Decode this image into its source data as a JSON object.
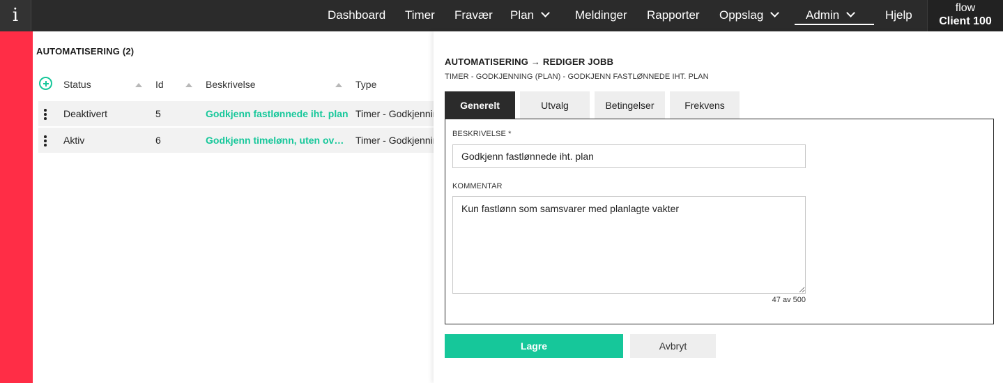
{
  "topbar": {
    "logo_text": "i",
    "nav": [
      {
        "label": "Dashboard",
        "dropdown": false
      },
      {
        "label": "Timer",
        "dropdown": false
      },
      {
        "label": "Fravær",
        "dropdown": false
      },
      {
        "label": "Plan",
        "dropdown": true
      },
      {
        "label": "Meldinger",
        "dropdown": false
      },
      {
        "label": "Rapporter",
        "dropdown": false
      },
      {
        "label": "Oppslag",
        "dropdown": true
      },
      {
        "label": "Admin",
        "dropdown": true,
        "active": true
      },
      {
        "label": "Hjelp",
        "dropdown": false
      }
    ],
    "client": {
      "line1": "flow",
      "line2": "Client 100"
    }
  },
  "list": {
    "title": "AUTOMATISERING (2)",
    "columns": [
      "Status",
      "Id",
      "Beskrivelse",
      "Type"
    ],
    "rows": [
      {
        "status": "Deaktivert",
        "id": "5",
        "beskrivelse": "Godkjenn fastlønnede iht. plan",
        "type": "Timer - Godkjenning"
      },
      {
        "status": "Aktiv",
        "id": "6",
        "beskrivelse": "Godkjenn timelønn, uten overtid",
        "type": "Timer - Godkjenning"
      }
    ]
  },
  "panel": {
    "title": "AUTOMATISERING → REDIGER JOBB",
    "subtitle": "TIMER - GODKJENNING (PLAN) - GODKJENN FASTLØNNEDE IHT. PLAN",
    "tabs": [
      "Generelt",
      "Utvalg",
      "Betingelser",
      "Frekvens"
    ],
    "active_tab": "Generelt",
    "form": {
      "beskrivelse_label": "BESKRIVELSE *",
      "beskrivelse_value": "Godkjenn fastlønnede iht. plan",
      "kommentar_label": "KOMMENTAR",
      "kommentar_value": "Kun fastlønn som samsvarer med planlagte vakter",
      "char_count": "47 av 500"
    },
    "buttons": {
      "save": "Lagre",
      "cancel": "Avbryt"
    }
  },
  "colors": {
    "accent": "#16c79a",
    "brand_red": "#ff2d46",
    "topbar": "#2b2b2b"
  }
}
